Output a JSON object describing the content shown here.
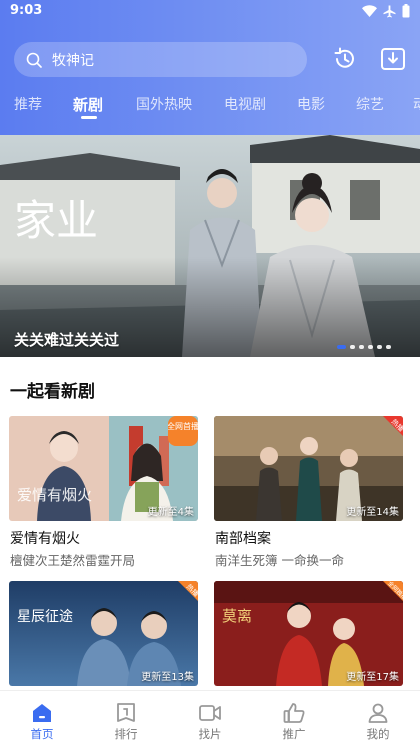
{
  "status_bar": {
    "time": "9:03"
  },
  "search": {
    "query": "牧神记"
  },
  "tabs": [
    {
      "label": "推荐"
    },
    {
      "label": "新剧"
    },
    {
      "label": "国外热映"
    },
    {
      "label": "电视剧"
    },
    {
      "label": "电影"
    },
    {
      "label": "综艺"
    },
    {
      "label": "动"
    }
  ],
  "active_tab": "新剧",
  "banner": {
    "caption": "关关难过关关过",
    "art_title": "家业",
    "slide_count": 6,
    "active_slide": 1
  },
  "section": {
    "title": "一起看新剧"
  },
  "cards": [
    {
      "title": "爱情有烟火",
      "subtitle": "檀健次王楚然雷霆开局",
      "update_note": "更新至4集",
      "badge": "全网首播",
      "poster_text": "爱情有烟火"
    },
    {
      "title": "南部档案",
      "subtitle": "南洋生死簿 一命换一命",
      "update_note": "更新至14集",
      "badge": "热播"
    },
    {
      "title": "",
      "subtitle": "",
      "update_note": "更新至13集",
      "badge": "热播",
      "poster_text": "星辰征途"
    },
    {
      "title": "",
      "subtitle": "",
      "update_note": "更新至17集",
      "badge": "全网独播",
      "poster_text": "莫离"
    }
  ],
  "bottom_nav": [
    {
      "label": "首页",
      "icon": "home-icon",
      "active": true
    },
    {
      "label": "排行",
      "icon": "ranking-icon",
      "active": false
    },
    {
      "label": "找片",
      "icon": "video-icon",
      "active": false
    },
    {
      "label": "推广",
      "icon": "thumbs-up-icon",
      "active": false
    },
    {
      "label": "我的",
      "icon": "profile-icon",
      "active": false
    }
  ],
  "colors": {
    "header_start": "#5b7cf0",
    "header_end": "#8aa4f5",
    "accent": "#3a6cf0",
    "badge_orange": "#f5822a",
    "badge_red": "#e8382e"
  }
}
